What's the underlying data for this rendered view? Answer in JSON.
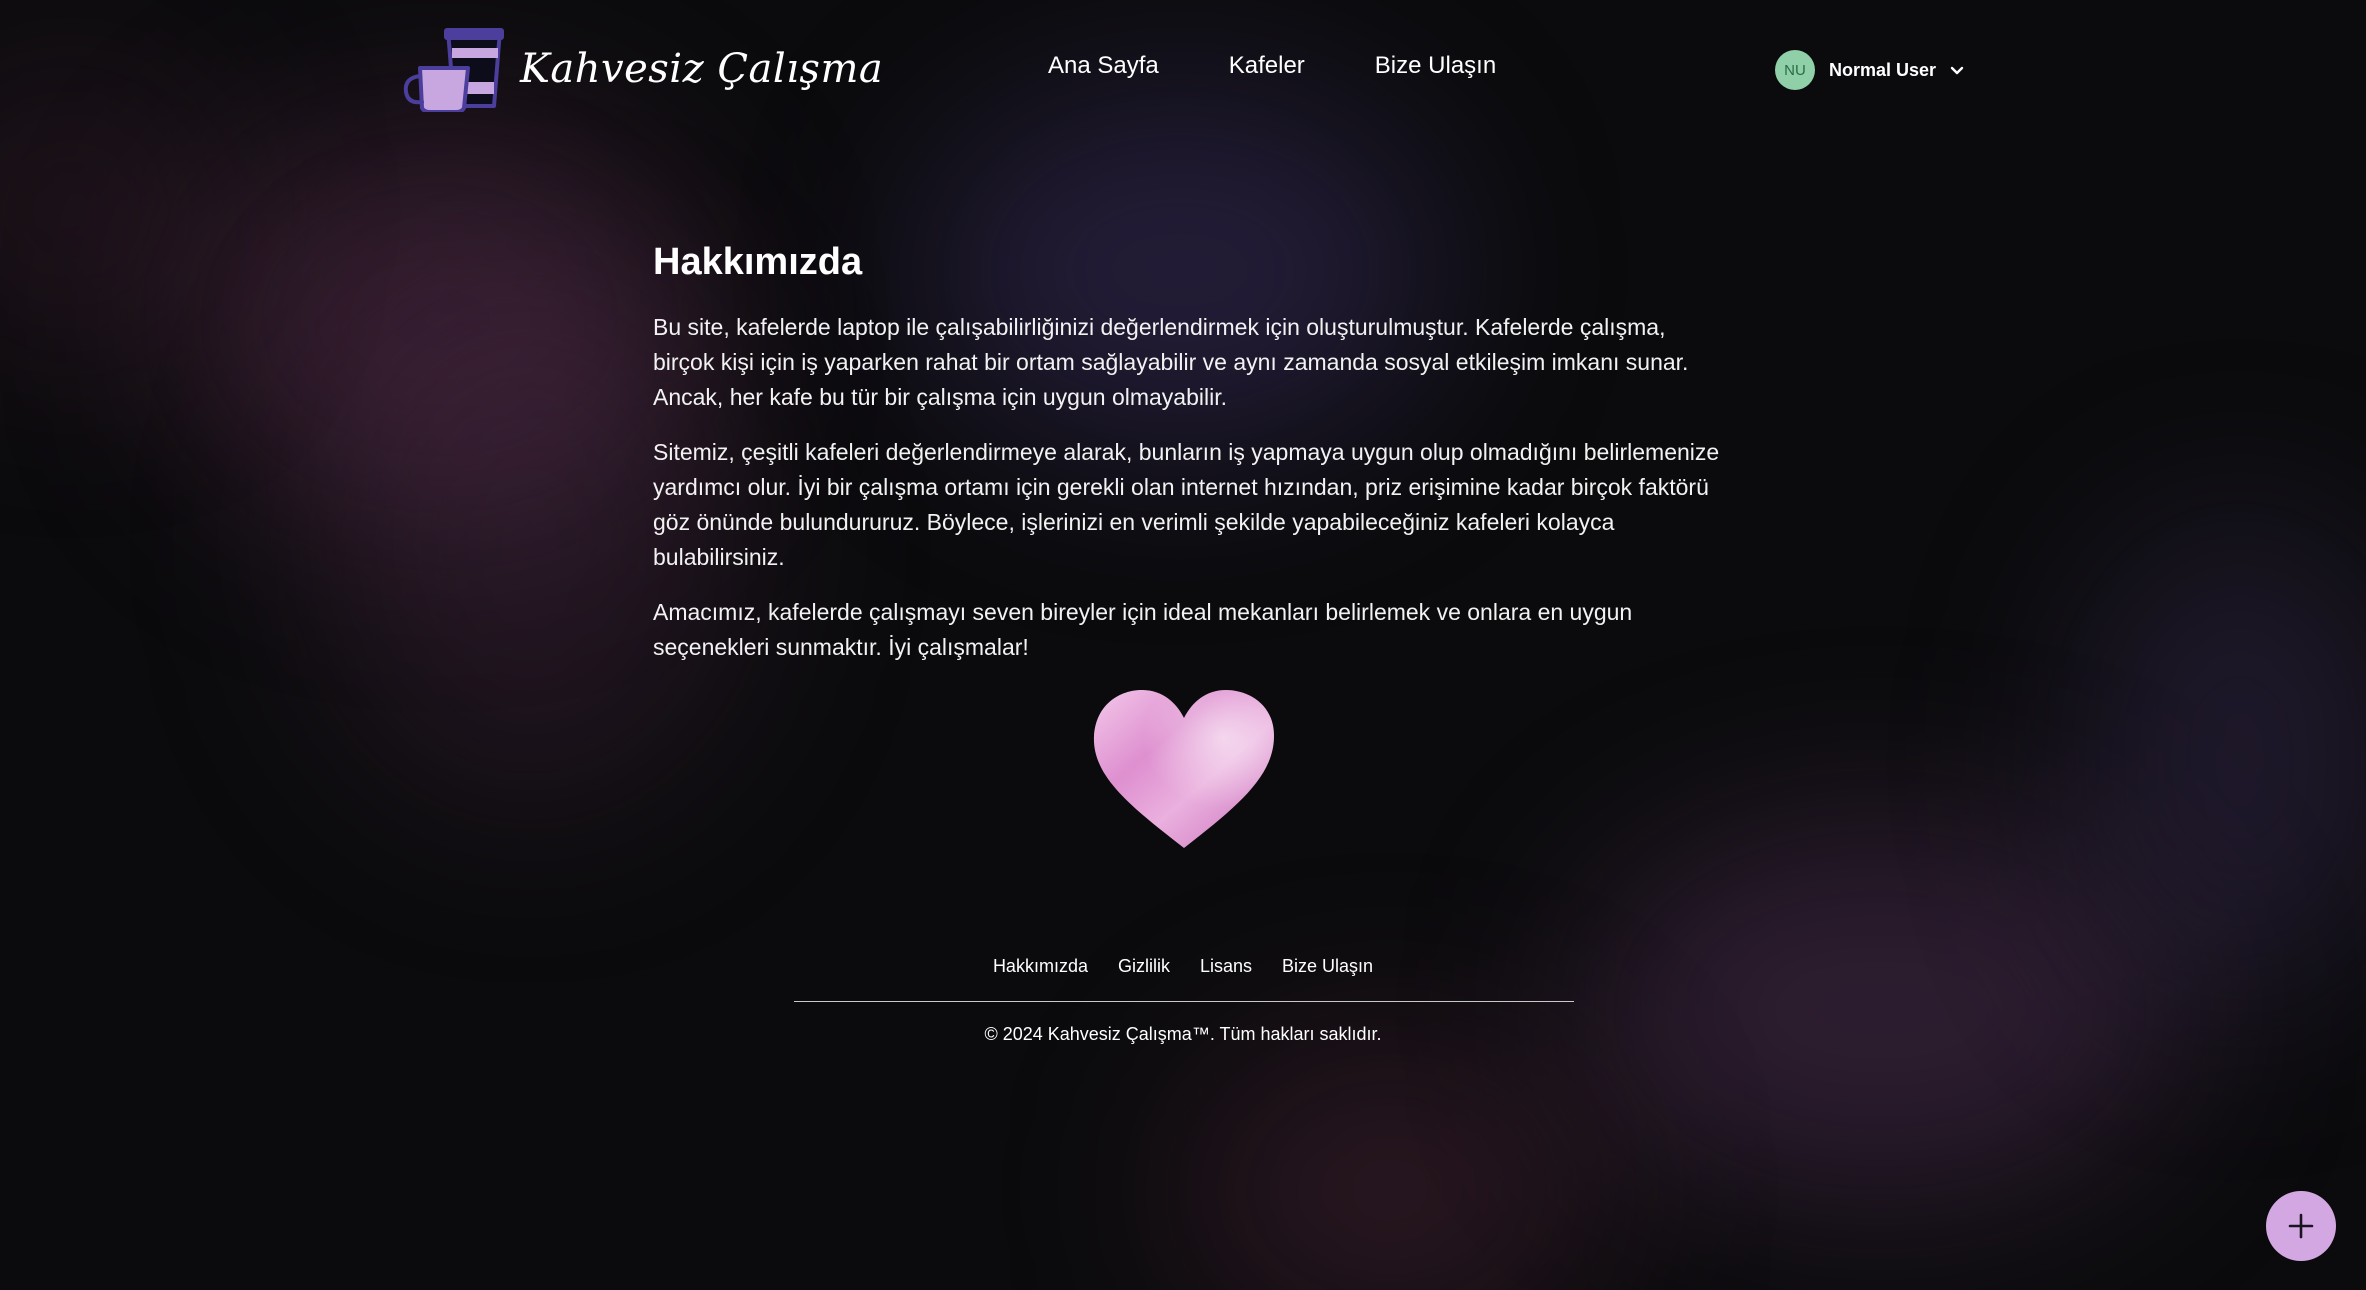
{
  "header": {
    "brand_name": "Kahvesiz Çalışma",
    "nav": [
      {
        "label": "Ana Sayfa"
      },
      {
        "label": "Kafeler"
      },
      {
        "label": "Bize Ulaşın"
      }
    ],
    "user": {
      "initials": "NU",
      "name": "Normal User",
      "avatar_color": "#8fd0a9"
    }
  },
  "main": {
    "title": "Hakkımızda",
    "paragraphs": [
      "Bu site, kafelerde laptop ile çalışabilirliğinizi değerlendirmek için oluşturulmuştur. Kafelerde çalışma, birçok kişi için iş yaparken rahat bir ortam sağlayabilir ve aynı zamanda sosyal etkileşim imkanı sunar. Ancak, her kafe bu tür bir çalışma için uygun olmayabilir.",
      "Sitemiz, çeşitli kafeleri değerlendirmeye alarak, bunların iş yapmaya uygun olup olmadığını belirlemenize yardımcı olur. İyi bir çalışma ortamı için gerekli olan internet hızından, priz erişimine kadar birçok faktörü göz önünde bulundururuz. Böylece, işlerinizi en verimli şekilde yapabileceğiniz kafeleri kolayca bulabilirsiniz.",
      "Amacımız, kafelerde çalışmayı seven bireyler için ideal mekanları belirlemek ve onlara en uygun seçenekleri sunmaktır. İyi çalışmalar!"
    ],
    "heart_icon": "heart-icon"
  },
  "footer": {
    "links": [
      {
        "label": "Hakkımızda"
      },
      {
        "label": "Gizlilik"
      },
      {
        "label": "Lisans"
      },
      {
        "label": "Bize Ulaşın"
      }
    ],
    "copyright": "© 2024 Kahvesiz Çalışma™. Tüm hakları saklıdır."
  },
  "fab": {
    "icon": "plus-icon",
    "color": "#d3a8e2"
  },
  "theme": {
    "background": "#0b0b0d",
    "accent": "#d3a8e2",
    "logo_color": "#c8a6e0"
  }
}
